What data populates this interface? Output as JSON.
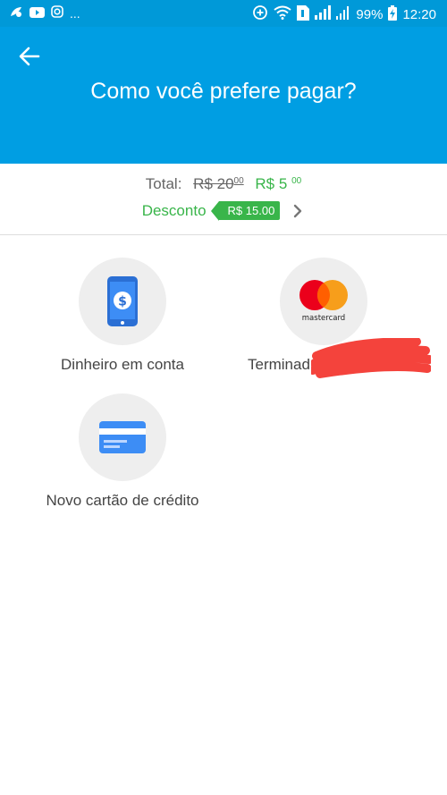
{
  "status_bar": {
    "notification_icons": [
      "feather-icon",
      "youtube-icon",
      "instagram-icon"
    ],
    "more": "...",
    "battery": "99%",
    "time": "12:20"
  },
  "header": {
    "title": "Como você prefere pagar?",
    "color": "#009ee3"
  },
  "summary": {
    "total_label": "Total:",
    "old_price_main": "R$ 20",
    "old_price_cents": "00",
    "new_price_main": "R$ 5",
    "new_price_cents": "00",
    "discount_label": "Desconto",
    "discount_value": "R$ 15.00",
    "accent_green": "#39b54a"
  },
  "payment_options": {
    "account_money": "Dinheiro em conta",
    "mastercard_brand": "mastercard",
    "card_ending": "Terminad",
    "new_credit_card": "Novo cartão de crédito"
  }
}
